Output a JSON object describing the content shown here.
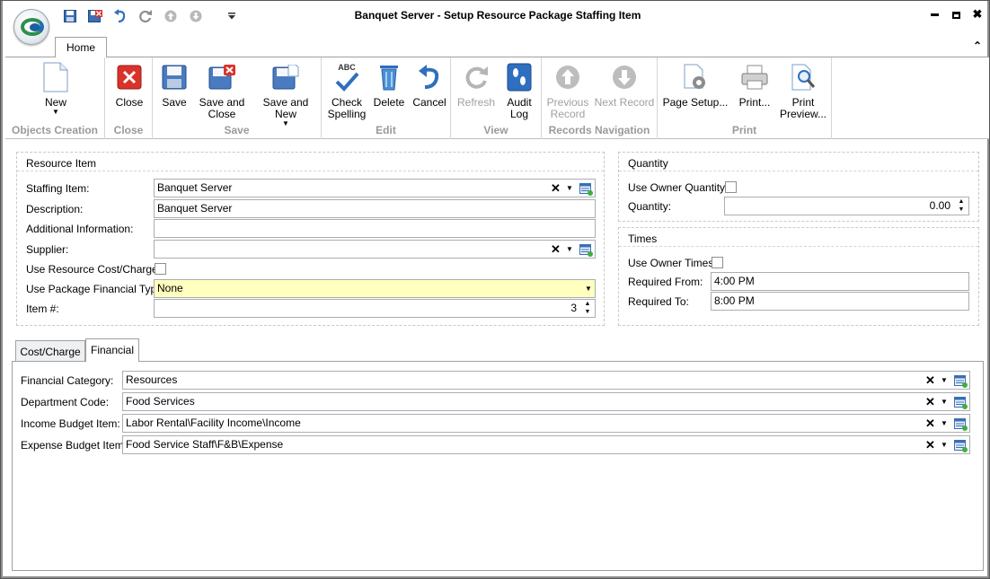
{
  "window": {
    "title": "Banquet Server - Setup Resource Package Staffing Item",
    "controls": {
      "minimize": "▬",
      "maximize": "■",
      "close": "✖"
    }
  },
  "quick_access": [
    "save-icon",
    "save-and-close-icon",
    "undo-icon",
    "redo-icon",
    "up-icon",
    "down-icon",
    "customize-icon"
  ],
  "ribbon": {
    "tab": "Home",
    "collapse_glyph": "⌃",
    "groups": [
      {
        "label": "Objects Creation",
        "buttons": [
          {
            "line1": "New",
            "line2": "",
            "caret": true,
            "disabled": false
          }
        ]
      },
      {
        "label": "Close",
        "buttons": [
          {
            "line1": "Close",
            "line2": "",
            "disabled": false
          }
        ]
      },
      {
        "label": "Save",
        "buttons": [
          {
            "line1": "Save",
            "line2": "",
            "disabled": false
          },
          {
            "line1": "Save and",
            "line2": "Close",
            "disabled": false
          },
          {
            "line1": "Save and New",
            "line2": "",
            "caret": true,
            "disabled": false
          }
        ]
      },
      {
        "label": "Edit",
        "buttons": [
          {
            "line1": "Check",
            "line2": "Spelling",
            "disabled": false
          },
          {
            "line1": "Delete",
            "line2": "",
            "disabled": false
          },
          {
            "line1": "Cancel",
            "line2": "",
            "disabled": false
          }
        ]
      },
      {
        "label": "View",
        "buttons": [
          {
            "line1": "Refresh",
            "line2": "",
            "disabled": true
          },
          {
            "line1": "Audit",
            "line2": "Log",
            "disabled": false
          }
        ]
      },
      {
        "label": "Records Navigation",
        "buttons": [
          {
            "line1": "Previous",
            "line2": "Record",
            "disabled": true
          },
          {
            "line1": "Next Record",
            "line2": "",
            "disabled": true
          }
        ]
      },
      {
        "label": "Print",
        "buttons": [
          {
            "line1": "Page Setup...",
            "line2": "",
            "disabled": false
          },
          {
            "line1": "Print...",
            "line2": "",
            "disabled": false
          },
          {
            "line1": "Print",
            "line2": "Preview...",
            "disabled": false
          }
        ]
      }
    ],
    "abc_text": "ABC"
  },
  "resource_item": {
    "title": "Resource Item",
    "staffing_item": {
      "label": "Staffing Item:",
      "value": "Banquet Server"
    },
    "description": {
      "label": "Description:",
      "value": "Banquet Server"
    },
    "additional_information": {
      "label": "Additional Information:",
      "value": ""
    },
    "supplier": {
      "label": "Supplier:",
      "value": ""
    },
    "use_resource_cost": {
      "label": "Use Resource Cost/Charge:",
      "checked": false
    },
    "use_package_financial_type": {
      "label": "Use Package Financial Type:",
      "value": "None"
    },
    "item_number": {
      "label": "Item #:",
      "value": "3"
    }
  },
  "quantity": {
    "title": "Quantity",
    "use_owner_quantity": {
      "label": "Use Owner Quantity:",
      "checked": false
    },
    "quantity": {
      "label": "Quantity:",
      "value": "0.00"
    }
  },
  "times": {
    "title": "Times",
    "use_owner_times": {
      "label": "Use Owner Times:",
      "checked": false
    },
    "required_from": {
      "label": "Required From:",
      "value": "4:00 PM"
    },
    "required_to": {
      "label": "Required To:",
      "value": "8:00 PM"
    }
  },
  "tabs": [
    {
      "label": "Cost/Charge",
      "active": false
    },
    {
      "label": "Financial",
      "active": true
    }
  ],
  "financial": {
    "financial_category": {
      "label": "Financial Category:",
      "value": "Resources"
    },
    "department_code": {
      "label": "Department Code:",
      "value": "Food Services"
    },
    "income_budget_item": {
      "label": "Income Budget Item:",
      "value": "Labor Rental\\Facility Income\\Income"
    },
    "expense_budget_item": {
      "label": "Expense Budget Item:",
      "value": "Food Service Staff\\F&B\\Expense"
    }
  },
  "glyphs": {
    "clear": "✕",
    "dropdown": "▼",
    "spin_up": "▲",
    "spin_down": "▼"
  },
  "colors": {
    "highlight_field": "#ffffc0",
    "close_red": "#d9322b",
    "disabled_gray": "#a0a0a0"
  }
}
